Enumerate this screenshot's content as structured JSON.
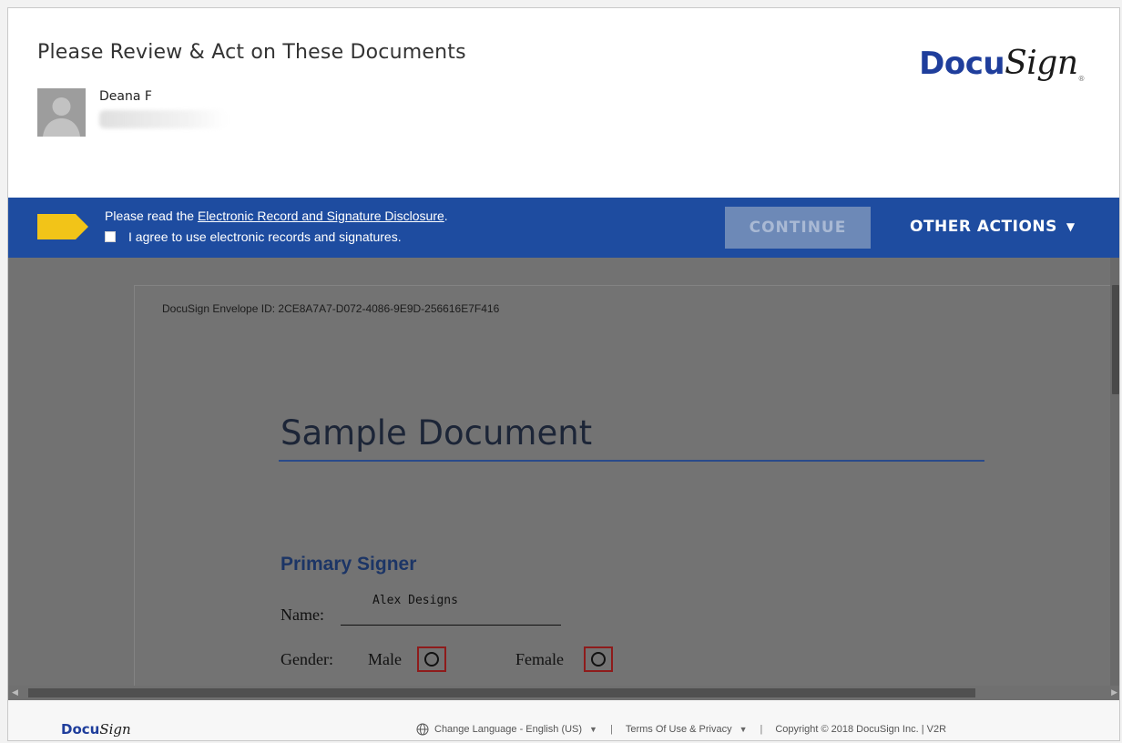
{
  "header": {
    "title": "Please Review & Act on These Documents",
    "sender_name": "Deana F",
    "brand": {
      "bold": "Docu",
      "script": "Sign",
      "reg": "®"
    }
  },
  "action_bar": {
    "disclosure_prefix": "Please read the ",
    "disclosure_link": "Electronic Record and Signature Disclosure",
    "disclosure_suffix": ".",
    "agree_label": "I agree to use electronic records and signatures.",
    "continue_label": "CONTINUE",
    "other_actions_label": "OTHER ACTIONS",
    "other_actions_caret": "▼"
  },
  "document": {
    "envelope_id": "DocuSign Envelope ID: 2CE8A7A7-D072-4086-9E9D-256616E7F416",
    "title": "Sample Document",
    "section_heading": "Primary Signer",
    "name_label": "Name:",
    "name_value": "Alex Designs",
    "gender_label": "Gender:",
    "male_label": "Male",
    "female_label": "Female"
  },
  "footer": {
    "logo_bold": "Docu",
    "logo_script": "Sign",
    "language": "Change Language - English (US)",
    "terms": "Terms Of Use & Privacy",
    "copyright": "Copyright © 2018 DocuSign Inc. | V2R",
    "separator": "|",
    "caret": "▼"
  },
  "colors": {
    "action_bar": "#1e4ca0",
    "flag": "#f2c418",
    "continue_disabled": "#6d89b7",
    "viewport": "#727272",
    "radio_border": "#8e1b1b"
  },
  "icons": {
    "avatar": "person-silhouette",
    "flag": "yellow-tag-flag",
    "globe": "globe-icon"
  }
}
